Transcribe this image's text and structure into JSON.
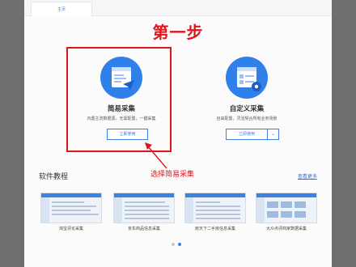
{
  "tabs": [
    {
      "label": "主页"
    }
  ],
  "step_title": "第一步",
  "cards": {
    "simple": {
      "title": "简易采集",
      "desc": "内置主流数据源，无需配置，一键采集",
      "button": "立即使用"
    },
    "custom": {
      "title": "自定义采集",
      "desc": "自由配置，灵活契合所有业务场景",
      "button": "立即使用"
    }
  },
  "annotation": "选择简易采集",
  "tutorials": {
    "title": "软件教程",
    "more": "查看更多",
    "items": [
      {
        "caption": "淘宝评论采集"
      },
      {
        "caption": "京东商品信息采集"
      },
      {
        "caption": "房天下二手房信息采集"
      },
      {
        "caption": "大众点评商家数据采集"
      }
    ]
  },
  "colors": {
    "accent": "#2f80e8",
    "annotation": "#e0151c"
  }
}
